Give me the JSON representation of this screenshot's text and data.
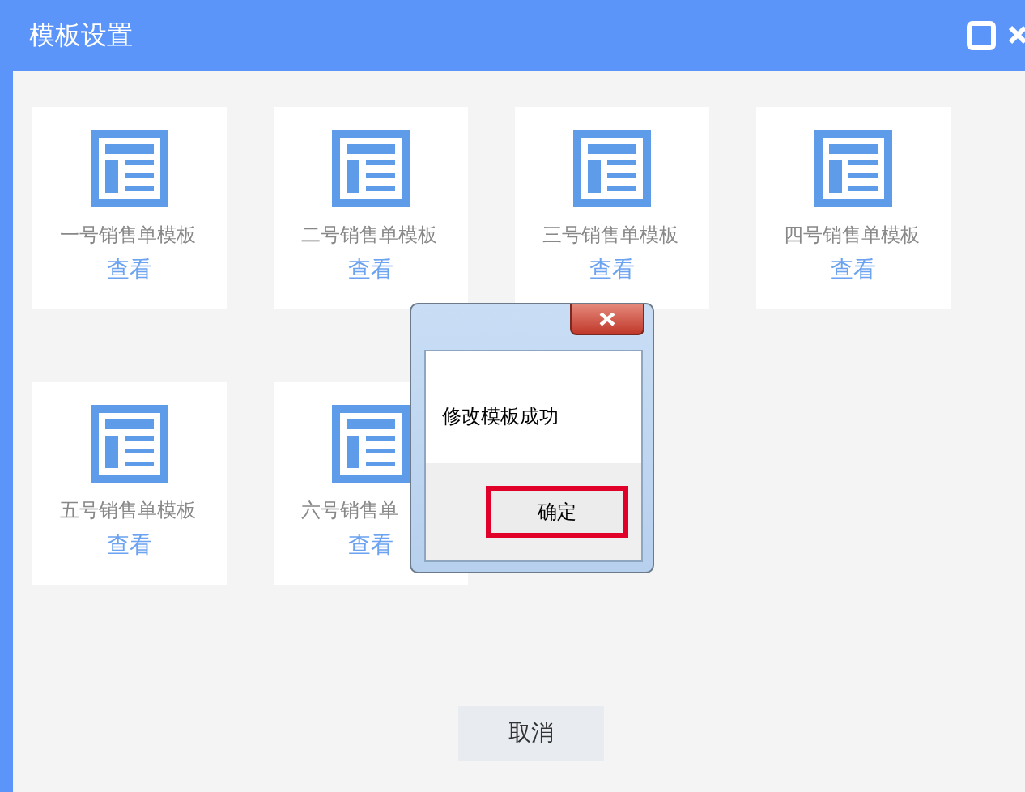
{
  "window": {
    "title": "模板设置"
  },
  "templates": [
    {
      "name": "一号销售单模板",
      "link": "查看"
    },
    {
      "name": "二号销售单模板",
      "link": "查看"
    },
    {
      "name": "三号销售单模板",
      "link": "查看"
    },
    {
      "name": "四号销售单模板",
      "link": "查看"
    },
    {
      "name": "五号销售单模板",
      "link": "查看"
    },
    {
      "name": "六号销售单",
      "link": "查看"
    }
  ],
  "cancel_button": "取消",
  "dialog": {
    "message": "修改模板成功",
    "ok_button": "确定"
  }
}
